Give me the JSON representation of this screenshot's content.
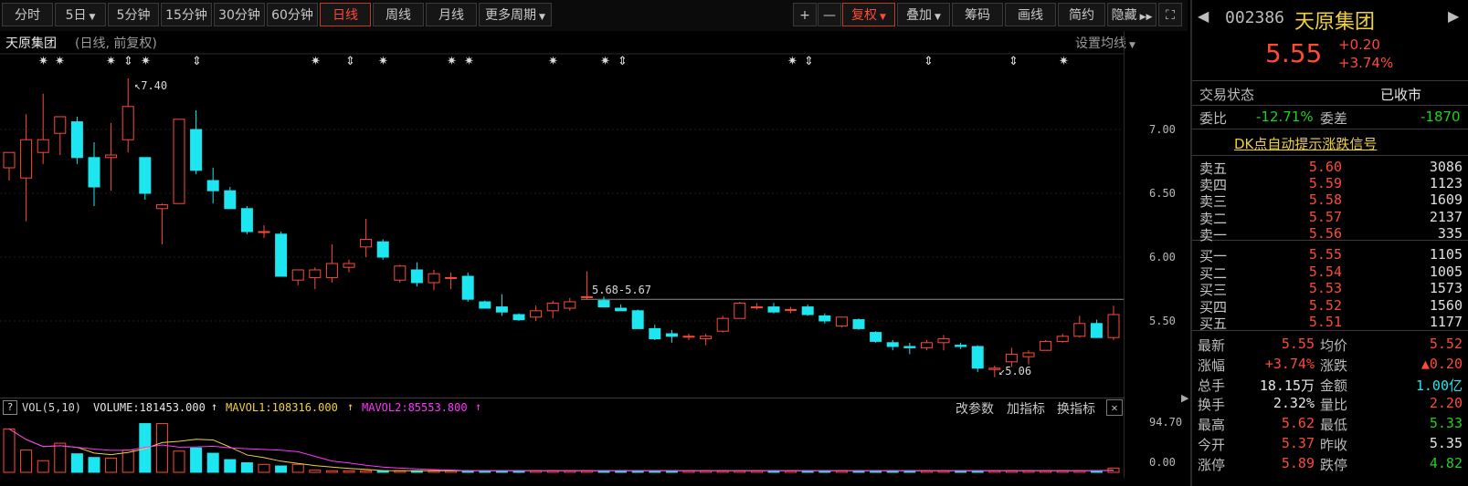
{
  "toolbar": {
    "periods": [
      {
        "label": "分时",
        "dropdown": false
      },
      {
        "label": "5日",
        "dropdown": true
      },
      {
        "label": "5分钟",
        "dropdown": false
      },
      {
        "label": "15分钟",
        "dropdown": false
      },
      {
        "label": "30分钟",
        "dropdown": false
      },
      {
        "label": "60分钟",
        "dropdown": false
      },
      {
        "label": "日线",
        "dropdown": false,
        "active": true
      },
      {
        "label": "周线",
        "dropdown": false
      },
      {
        "label": "月线",
        "dropdown": false
      },
      {
        "label": "更多周期",
        "dropdown": true
      }
    ],
    "zoom_in": "+",
    "zoom_out": "—",
    "fuquan": "复权",
    "diejia": "叠加",
    "choumu": "筹码",
    "huaxian": "画线",
    "jianyue": "简约",
    "yincang": "隐藏"
  },
  "chart": {
    "stock_name": "天原集团",
    "adjust_mode": "(日线, 前复权)",
    "set_ma": "设置均线",
    "y_ticks": [
      "7.00",
      "6.50",
      "6.00",
      "5.50"
    ],
    "high_label": "7.40",
    "low_label": "5.06",
    "range_label": "5.68-5.67",
    "colors": {
      "up": "#ff4a36",
      "down": "#1ee6f0",
      "background": "#000000"
    }
  },
  "chart_data": {
    "type": "candlestick",
    "candles": [
      {
        "o": 6.7,
        "h": 6.8,
        "l": 6.6,
        "c": 6.82
      },
      {
        "o": 6.62,
        "h": 7.12,
        "l": 6.28,
        "c": 6.92
      },
      {
        "o": 6.82,
        "h": 7.28,
        "l": 6.73,
        "c": 6.92
      },
      {
        "o": 6.97,
        "h": 7.1,
        "l": 6.8,
        "c": 7.1
      },
      {
        "o": 7.06,
        "h": 7.1,
        "l": 6.73,
        "c": 6.78
      },
      {
        "o": 6.78,
        "h": 6.9,
        "l": 6.4,
        "c": 6.55
      },
      {
        "o": 6.78,
        "h": 7.05,
        "l": 6.52,
        "c": 6.8
      },
      {
        "o": 6.92,
        "h": 7.4,
        "l": 6.82,
        "c": 7.18
      },
      {
        "o": 6.78,
        "h": 6.78,
        "l": 6.45,
        "c": 6.5
      },
      {
        "o": 6.38,
        "h": 6.42,
        "l": 6.1,
        "c": 6.41
      },
      {
        "o": 6.42,
        "h": 7.08,
        "l": 6.42,
        "c": 7.08
      },
      {
        "o": 7.0,
        "h": 7.15,
        "l": 6.65,
        "c": 6.68
      },
      {
        "o": 6.6,
        "h": 6.7,
        "l": 6.42,
        "c": 6.52
      },
      {
        "o": 6.52,
        "h": 6.55,
        "l": 6.38,
        "c": 6.38
      },
      {
        "o": 6.38,
        "h": 6.4,
        "l": 6.18,
        "c": 6.2
      },
      {
        "o": 6.2,
        "h": 6.25,
        "l": 6.15,
        "c": 6.2
      },
      {
        "o": 6.18,
        "h": 6.2,
        "l": 5.85,
        "c": 5.85
      },
      {
        "o": 5.82,
        "h": 5.9,
        "l": 5.78,
        "c": 5.9
      },
      {
        "o": 5.84,
        "h": 5.92,
        "l": 5.75,
        "c": 5.9
      },
      {
        "o": 5.84,
        "h": 6.1,
        "l": 5.8,
        "c": 5.95
      },
      {
        "o": 5.92,
        "h": 5.98,
        "l": 5.88,
        "c": 5.95
      },
      {
        "o": 6.08,
        "h": 6.3,
        "l": 6.0,
        "c": 6.14
      },
      {
        "o": 6.12,
        "h": 6.14,
        "l": 5.98,
        "c": 6.0
      },
      {
        "o": 5.82,
        "h": 5.94,
        "l": 5.8,
        "c": 5.93
      },
      {
        "o": 5.9,
        "h": 5.96,
        "l": 5.77,
        "c": 5.8
      },
      {
        "o": 5.8,
        "h": 5.9,
        "l": 5.74,
        "c": 5.87
      },
      {
        "o": 5.84,
        "h": 5.88,
        "l": 5.75,
        "c": 5.84
      },
      {
        "o": 5.85,
        "h": 5.88,
        "l": 5.65,
        "c": 5.67
      },
      {
        "o": 5.65,
        "h": 5.66,
        "l": 5.6,
        "c": 5.6
      },
      {
        "o": 5.61,
        "h": 5.71,
        "l": 5.54,
        "c": 5.57
      },
      {
        "o": 5.55,
        "h": 5.56,
        "l": 5.5,
        "c": 5.51
      },
      {
        "o": 5.53,
        "h": 5.62,
        "l": 5.5,
        "c": 5.58
      },
      {
        "o": 5.58,
        "h": 5.66,
        "l": 5.52,
        "c": 5.64
      },
      {
        "o": 5.6,
        "h": 5.68,
        "l": 5.58,
        "c": 5.65
      },
      {
        "o": 5.69,
        "h": 5.89,
        "l": 5.67,
        "c": 5.69
      },
      {
        "o": 5.66,
        "h": 5.69,
        "l": 5.61,
        "c": 5.61
      },
      {
        "o": 5.6,
        "h": 5.63,
        "l": 5.58,
        "c": 5.58
      },
      {
        "o": 5.58,
        "h": 5.59,
        "l": 5.44,
        "c": 5.44
      },
      {
        "o": 5.44,
        "h": 5.47,
        "l": 5.35,
        "c": 5.36
      },
      {
        "o": 5.4,
        "h": 5.43,
        "l": 5.33,
        "c": 5.38
      },
      {
        "o": 5.38,
        "h": 5.4,
        "l": 5.35,
        "c": 5.38
      },
      {
        "o": 5.36,
        "h": 5.4,
        "l": 5.31,
        "c": 5.38
      },
      {
        "o": 5.42,
        "h": 5.54,
        "l": 5.41,
        "c": 5.52
      },
      {
        "o": 5.52,
        "h": 5.65,
        "l": 5.52,
        "c": 5.64
      },
      {
        "o": 5.61,
        "h": 5.64,
        "l": 5.59,
        "c": 5.61
      },
      {
        "o": 5.61,
        "h": 5.64,
        "l": 5.56,
        "c": 5.57
      },
      {
        "o": 5.59,
        "h": 5.61,
        "l": 5.56,
        "c": 5.59
      },
      {
        "o": 5.61,
        "h": 5.63,
        "l": 5.54,
        "c": 5.55
      },
      {
        "o": 5.54,
        "h": 5.56,
        "l": 5.48,
        "c": 5.5
      },
      {
        "o": 5.46,
        "h": 5.53,
        "l": 5.45,
        "c": 5.53
      },
      {
        "o": 5.51,
        "h": 5.52,
        "l": 5.43,
        "c": 5.44
      },
      {
        "o": 5.41,
        "h": 5.42,
        "l": 5.33,
        "c": 5.34
      },
      {
        "o": 5.33,
        "h": 5.35,
        "l": 5.27,
        "c": 5.3
      },
      {
        "o": 5.3,
        "h": 5.33,
        "l": 5.24,
        "c": 5.29
      },
      {
        "o": 5.29,
        "h": 5.35,
        "l": 5.27,
        "c": 5.33
      },
      {
        "o": 5.33,
        "h": 5.39,
        "l": 5.27,
        "c": 5.36
      },
      {
        "o": 5.31,
        "h": 5.33,
        "l": 5.28,
        "c": 5.3
      },
      {
        "o": 5.3,
        "h": 5.31,
        "l": 5.1,
        "c": 5.13
      },
      {
        "o": 5.12,
        "h": 5.15,
        "l": 5.06,
        "c": 5.13
      },
      {
        "o": 5.18,
        "h": 5.29,
        "l": 5.14,
        "c": 5.24
      },
      {
        "o": 5.22,
        "h": 5.27,
        "l": 5.16,
        "c": 5.25
      },
      {
        "o": 5.27,
        "h": 5.35,
        "l": 5.27,
        "c": 5.34
      },
      {
        "o": 5.34,
        "h": 5.4,
        "l": 5.33,
        "c": 5.38
      },
      {
        "o": 5.38,
        "h": 5.54,
        "l": 5.37,
        "c": 5.48
      },
      {
        "o": 5.48,
        "h": 5.51,
        "l": 5.37,
        "c": 5.37
      },
      {
        "o": 5.37,
        "h": 5.62,
        "l": 5.35,
        "c": 5.55
      }
    ],
    "volume": {
      "ticks": [
        "94.70",
        "0.00"
      ],
      "values": [
        82,
        42,
        22,
        55,
        35,
        28,
        27,
        42,
        92,
        92,
        40,
        46,
        36,
        24,
        18,
        15,
        12,
        15,
        4,
        3,
        3,
        3,
        3,
        3,
        3,
        3,
        3,
        3,
        3,
        3,
        3,
        3,
        3,
        3,
        3,
        3,
        3,
        3,
        3,
        3,
        3,
        3,
        3,
        3,
        3,
        3,
        3,
        3,
        3,
        3,
        3,
        3,
        3,
        3,
        3,
        3,
        3,
        3,
        3,
        3,
        3,
        3,
        3,
        3,
        3,
        8
      ]
    }
  },
  "volume_panel": {
    "help": "?",
    "name": "VOL(5,10)",
    "volume": "VOLUME:181453.000",
    "mavol1": "MAVOL1:108316.000",
    "mavol2": "MAVOL2:85553.800",
    "gaicanshu": "改参数",
    "jiazhibiao": "加指标",
    "huanzhibiao": "换指标",
    "close": "✕"
  },
  "quote": {
    "code": "002386",
    "name": "天原集团",
    "price": "5.55",
    "change": "+0.20",
    "change_pct": "+3.74%",
    "status_label": "交易状态",
    "status_value": "已收市",
    "weibi_label": "委比",
    "weibi_value": "-12.71%",
    "weicha_label": "委差",
    "weicha_value": "-1870",
    "dk_link": "DK点自动提示涨跌信号",
    "asks": [
      {
        "name": "卖五",
        "price": "5.60",
        "vol": "3086"
      },
      {
        "name": "卖四",
        "price": "5.59",
        "vol": "1123"
      },
      {
        "name": "卖三",
        "price": "5.58",
        "vol": "1609"
      },
      {
        "name": "卖二",
        "price": "5.57",
        "vol": "2137"
      },
      {
        "name": "卖一",
        "price": "5.56",
        "vol": "335"
      }
    ],
    "bids": [
      {
        "name": "买一",
        "price": "5.55",
        "vol": "1105"
      },
      {
        "name": "买二",
        "price": "5.54",
        "vol": "1005"
      },
      {
        "name": "买三",
        "price": "5.53",
        "vol": "1573"
      },
      {
        "name": "买四",
        "price": "5.52",
        "vol": "1560"
      },
      {
        "name": "买五",
        "price": "5.51",
        "vol": "1177"
      }
    ],
    "stats": [
      {
        "l1": "最新",
        "v1": "5.55",
        "c1": "red",
        "l2": "均价",
        "v2": "5.52",
        "c2": "red"
      },
      {
        "l1": "涨幅",
        "v1": "+3.74%",
        "c1": "red",
        "l2": "涨跌",
        "v2": "▲0.20",
        "c2": "red"
      },
      {
        "l1": "总手",
        "v1": "18.15万",
        "c1": "white",
        "l2": "金额",
        "v2": "1.00亿",
        "c2": "cyan"
      },
      {
        "l1": "换手",
        "v1": "2.32%",
        "c1": "white",
        "l2": "量比",
        "v2": "2.20",
        "c2": "red"
      },
      {
        "l1": "最高",
        "v1": "5.62",
        "c1": "red",
        "l2": "最低",
        "v2": "5.33",
        "c2": "green"
      },
      {
        "l1": "今开",
        "v1": "5.37",
        "c1": "red",
        "l2": "昨收",
        "v2": "5.35",
        "c2": "white"
      },
      {
        "l1": "涨停",
        "v1": "5.89",
        "c1": "red",
        "l2": "跌停",
        "v2": "4.82",
        "c2": "green"
      }
    ]
  }
}
